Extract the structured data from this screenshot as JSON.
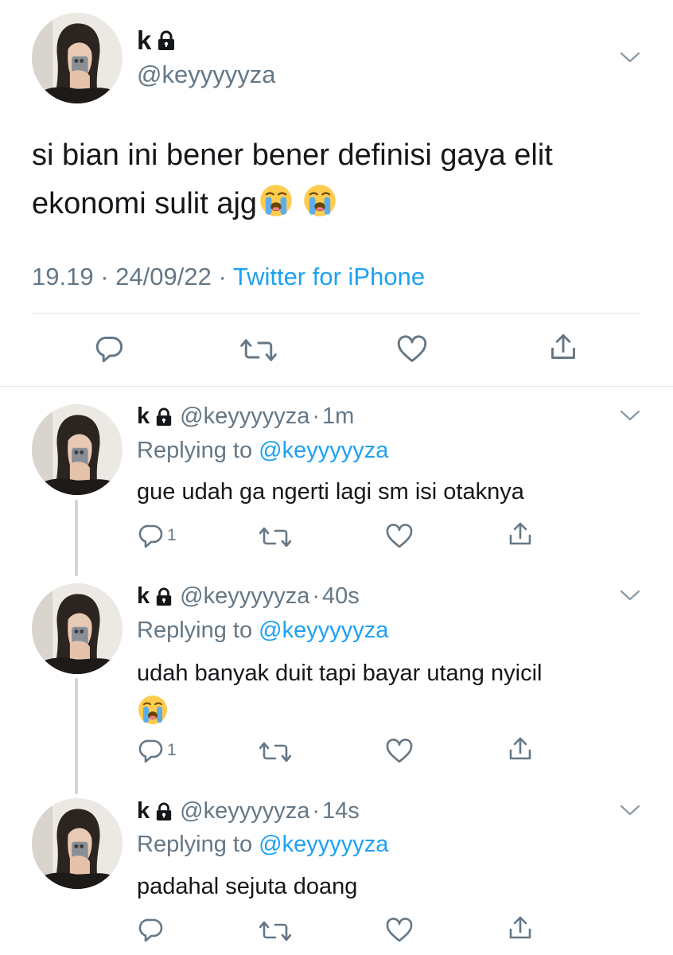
{
  "main_tweet": {
    "name": "k",
    "handle": "@keyyyyyza",
    "text": "si bian ini bener bener definisi gaya elit ekonomi sulit ajg",
    "time": "19.19",
    "date": "24/09/22",
    "source": "Twitter for iPhone",
    "separator": "·"
  },
  "replies": [
    {
      "name": "k",
      "handle": "@keyyyyyza",
      "time": "1m",
      "replying_label": "Replying to",
      "replying_to": "@keyyyyyza",
      "text": "gue udah ga ngerti lagi sm isi otaknya",
      "reply_count": "1"
    },
    {
      "name": "k",
      "handle": "@keyyyyyza",
      "time": "40s",
      "replying_label": "Replying to",
      "replying_to": "@keyyyyyza",
      "text": "udah banyak duit tapi bayar utang nyicil",
      "reply_count": "1"
    },
    {
      "name": "k",
      "handle": "@keyyyyyza",
      "time": "14s",
      "replying_label": "Replying to",
      "replying_to": "@keyyyyyza",
      "text": "padahal sejuta doang",
      "reply_count": ""
    }
  ],
  "icons": [
    "lock-icon",
    "chevron-down-icon",
    "reply-icon",
    "retweet-icon",
    "like-icon",
    "share-icon",
    "crying-face-emoji"
  ],
  "colors": {
    "text": "#14171a",
    "secondary": "#657786",
    "accent": "#1da1f2",
    "divider": "#e1e8ed"
  }
}
